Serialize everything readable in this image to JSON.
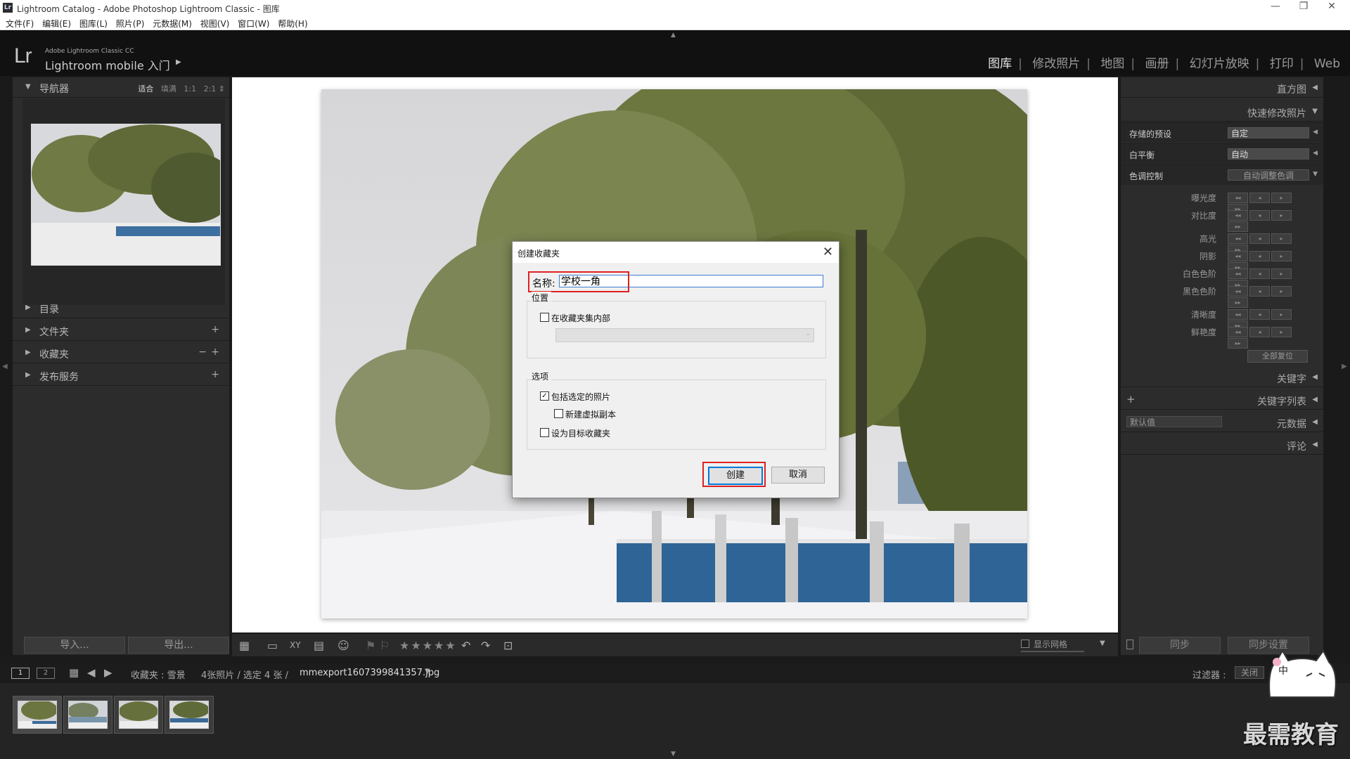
{
  "window": {
    "title": "Lightroom Catalog - Adobe Photoshop Lightroom Classic - 图库",
    "app_icon": "Lr"
  },
  "menu": [
    "文件(F)",
    "编辑(E)",
    "图库(L)",
    "照片(P)",
    "元数据(M)",
    "视图(V)",
    "窗口(W)",
    "帮助(H)"
  ],
  "header": {
    "logo": "Lr",
    "product_line": "Adobe Lightroom Classic CC",
    "identity": "Lightroom mobile 入门",
    "modules": [
      "图库",
      "修改照片",
      "地图",
      "画册",
      "幻灯片放映",
      "打印",
      "Web"
    ],
    "active_module": "图库"
  },
  "left_panel": {
    "navigator": {
      "label": "导航器",
      "zoom_options": [
        "适合",
        "填满",
        "1:1",
        "2:1"
      ]
    },
    "sections": [
      {
        "label": "目录",
        "plus": "",
        "minus": ""
      },
      {
        "label": "文件夹",
        "plus": "+",
        "minus": ""
      },
      {
        "label": "收藏夹",
        "plus": "+",
        "minus": "−"
      },
      {
        "label": "发布服务",
        "plus": "+",
        "minus": ""
      }
    ],
    "import_button": "导入...",
    "export_button": "导出..."
  },
  "right_panel": {
    "histogram": "直方图",
    "quick_develop": "快速修改照片",
    "saved_preset": {
      "label": "存储的预设",
      "value": "自定"
    },
    "white_balance": {
      "label": "白平衡",
      "value": "自动"
    },
    "tone_control": {
      "label": "色调控制",
      "auto_button": "自动调整色调"
    },
    "adjustments": [
      "曝光度",
      "对比度",
      "高光",
      "阴影",
      "白色色阶",
      "黑色色阶",
      "清晰度",
      "鲜艳度"
    ],
    "reset_all": "全部复位",
    "keywording": "关键字",
    "keyword_list": "关键字列表",
    "metadata": {
      "label": "元数据",
      "preset": "默认值"
    },
    "comments": "评论",
    "sync_button": "同步",
    "sync_settings_button": "同步设置"
  },
  "toolbar": {
    "rating": "★★★★★",
    "show_grid": "显示网格"
  },
  "filmstrip_bar": {
    "view1": "1",
    "view2": "2",
    "source": "收藏夹 : 雪景",
    "count": "4张照片 / 选定 4 张 /",
    "filename": "mmexport1607399841357.jpg",
    "filter_label": "过滤器 :",
    "filter_value": "关闭"
  },
  "dialog": {
    "title": "创建收藏夹",
    "name_label": "名称:",
    "name_value": "学校一角",
    "location_group": "位置",
    "inside_set_label": "在收藏夹集内部",
    "inside_set_checked": false,
    "options_group": "选项",
    "include_selected_label": "包括选定的照片",
    "include_selected_checked": true,
    "new_virtual_copies_label": "新建虚拟副本",
    "new_virtual_copies_checked": false,
    "set_target_label": "设为目标收藏夹",
    "set_target_checked": false,
    "create_button": "创建",
    "cancel_button": "取消"
  },
  "watermark": "最需教育",
  "ime_badge": "中"
}
